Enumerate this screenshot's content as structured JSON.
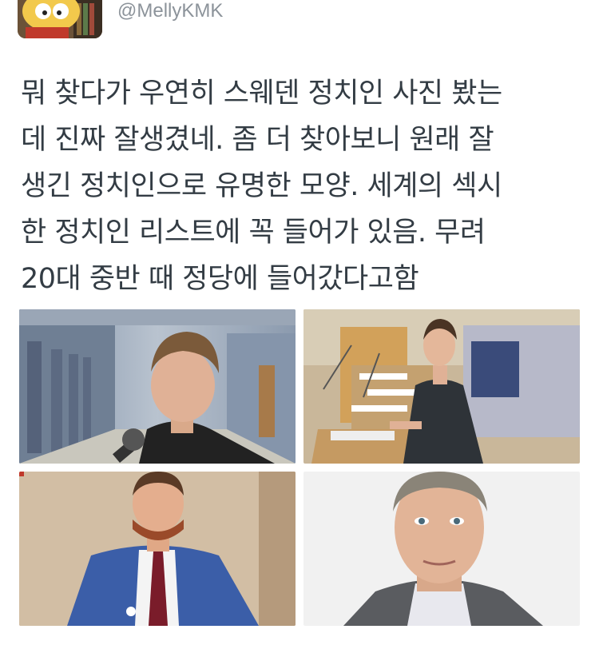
{
  "tweet": {
    "handle": "@MellyKMK",
    "text_lines": [
      "뭐 찾다가 우연히 스웨덴 정치인 사진 봤는",
      "데 진짜 잘생겼네. 좀 더 찾아보니 원래 잘",
      "생긴 정치인으로 유명한 모양. 세계의 섹시",
      "한 정치인 리스트에 꼭 들어가 있음. 무려",
      "20대 중반 때 정당에 들어갔다고함"
    ]
  },
  "media": [
    {
      "name": "photo-interview"
    },
    {
      "name": "photo-podium"
    },
    {
      "name": "photo-blue-suit"
    },
    {
      "name": "photo-portrait"
    }
  ],
  "colors": {
    "text": "#333c44",
    "handle": "#8c939a",
    "background": "#ffffff"
  }
}
